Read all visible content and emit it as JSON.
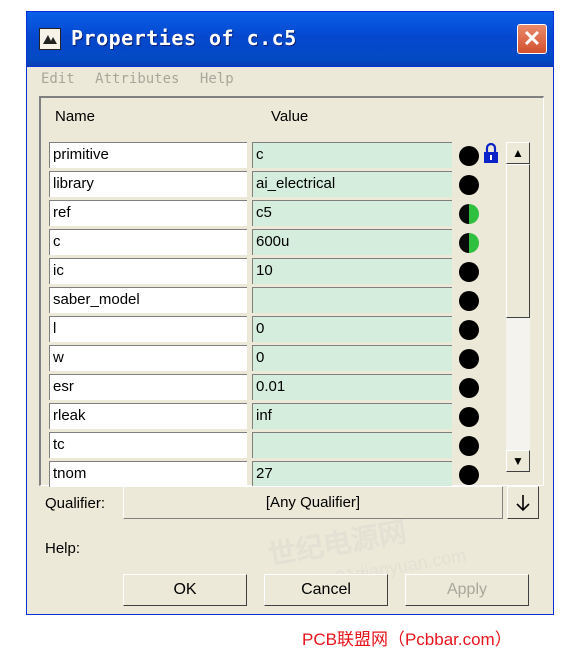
{
  "window": {
    "title": "Properties of c.c5"
  },
  "menu": [
    "Edit",
    "Attributes",
    "Help"
  ],
  "columns": {
    "name": "Name",
    "value": "Value"
  },
  "rows": [
    {
      "name": "primitive",
      "value": "c",
      "dot": "black",
      "locked": true
    },
    {
      "name": "library",
      "value": "ai_electrical",
      "dot": "black"
    },
    {
      "name": "ref",
      "value": "c5",
      "dot": "green-half"
    },
    {
      "name": "c",
      "value": "600u",
      "dot": "green-half"
    },
    {
      "name": "ic",
      "value": "10",
      "dot": "black"
    },
    {
      "name": "saber_model",
      "value": "",
      "dot": "black"
    },
    {
      "name": "l",
      "value": "0",
      "dot": "black"
    },
    {
      "name": "w",
      "value": "0",
      "dot": "black"
    },
    {
      "name": "esr",
      "value": "0.01",
      "dot": "black"
    },
    {
      "name": "rleak",
      "value": "inf",
      "dot": "black"
    },
    {
      "name": "tc",
      "value": "",
      "dot": "black"
    },
    {
      "name": "tnom",
      "value": "27",
      "dot": "black"
    }
  ],
  "qualifier": {
    "label": "Qualifier:",
    "value": "[Any Qualifier]"
  },
  "help": {
    "label": "Help:"
  },
  "buttons": {
    "ok": "OK",
    "cancel": "Cancel",
    "apply": "Apply"
  },
  "watermark": {
    "cn": "世纪电源网",
    "url": "www.21dianyuan.com"
  },
  "footer": "PCB联盟网（Pcbbar.com）",
  "colors": {
    "value_bg": "#d4eddc",
    "title_bar": "#0548cf",
    "footer_text": "#e8141c"
  }
}
